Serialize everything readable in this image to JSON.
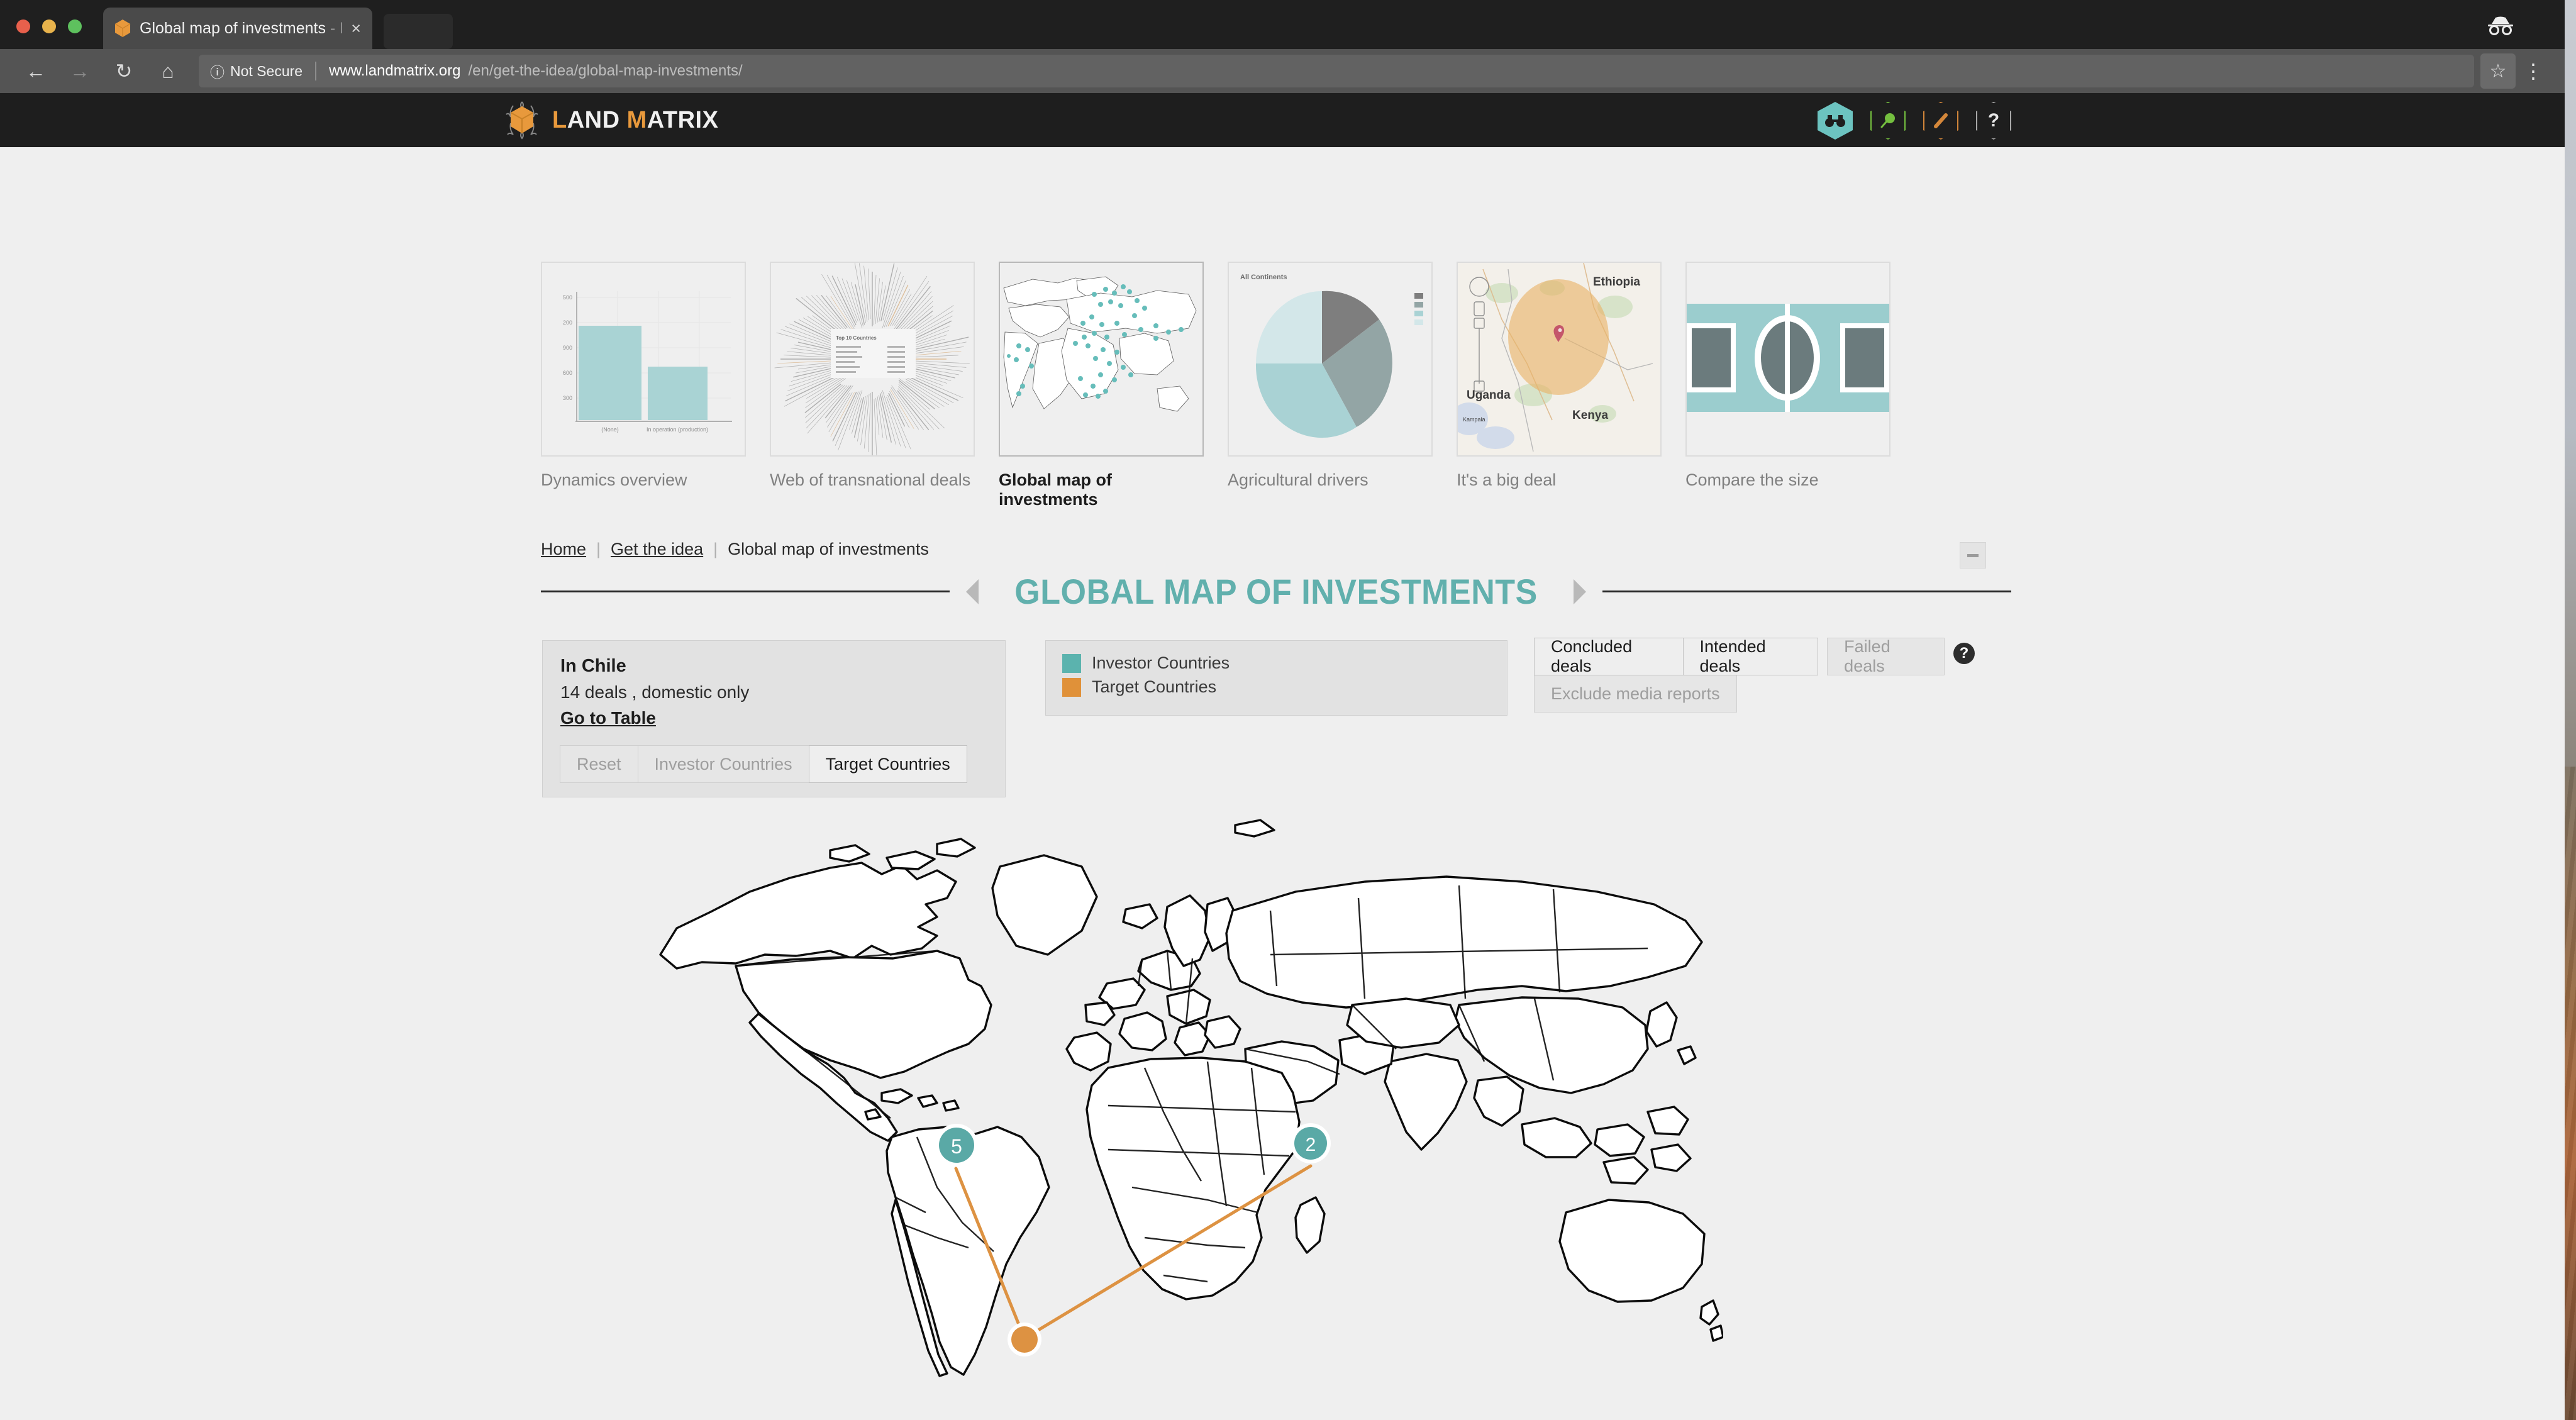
{
  "browser": {
    "tab_title": "Global map of investments",
    "tab_title_dim": " - L",
    "tab_close": "×",
    "url_notsecure": "Not Secure",
    "url_host": "www.landmatrix.org",
    "url_path": "/en/get-the-idea/global-map-investments/",
    "back_icon": "←",
    "forward_icon": "→",
    "reload_icon": "↻",
    "home_icon": "⌂",
    "star_icon": "☆",
    "kebab_icon": "⋮",
    "info_icon": "ⓘ"
  },
  "site": {
    "logo_first": "L",
    "logo_rest_1": "AND ",
    "logo_m": "M",
    "logo_rest_2": "ATRIX",
    "icons": [
      {
        "name": "binoculars-icon",
        "glyph": "🔭",
        "color": "#6cc3c0",
        "filled": true
      },
      {
        "name": "magnifier-icon",
        "glyph": "⚲",
        "color": "#74bf3f",
        "filled": false
      },
      {
        "name": "pencil-icon",
        "glyph": "╱",
        "color": "#d4873a",
        "filled": false
      },
      {
        "name": "question-icon",
        "glyph": "?",
        "color": "#a8a8a8",
        "filled": false
      }
    ]
  },
  "thumbnails": [
    {
      "label": "Dynamics overview",
      "kind": "bar",
      "active": false
    },
    {
      "label": "Web of transnational deals",
      "kind": "web",
      "active": false
    },
    {
      "label": "Global map of investments",
      "kind": "map",
      "active": true
    },
    {
      "label": "Agricultural drivers",
      "kind": "pie",
      "active": false
    },
    {
      "label": "It's a big deal",
      "kind": "geomap",
      "active": false
    },
    {
      "label": "Compare the size",
      "kind": "compare",
      "active": false
    }
  ],
  "thumb_details": {
    "bar": {
      "yticks": [
        "500",
        "200",
        "900",
        "600",
        "300"
      ],
      "xlabels": [
        "(None)",
        "In operation (production)"
      ],
      "values": [
        100,
        58
      ]
    },
    "web": {
      "caption": "Top 10 Countries"
    },
    "pie": {
      "title": "All Continents",
      "slices": [
        26,
        22,
        27,
        25
      ]
    },
    "geomap": {
      "labels": [
        "Ethiopia",
        "Uganda",
        "Kenya",
        "Kampala"
      ]
    }
  },
  "breadcrumb": {
    "home": "Home",
    "section": "Get the idea",
    "current": "Global map of investments",
    "separator": "|"
  },
  "title": "GLOBAL MAP OF INVESTMENTS",
  "info_panel": {
    "heading": "In Chile",
    "subtext": "14 deals , domestic only",
    "link": "Go to Table",
    "buttons": [
      {
        "label": "Reset",
        "active": false
      },
      {
        "label": "Investor Countries",
        "active": false
      },
      {
        "label": "Target Countries",
        "active": true
      }
    ]
  },
  "legend": {
    "items": [
      {
        "label": "Investor Countries",
        "color": "#5bb3ae"
      },
      {
        "label": "Target Countries",
        "color": "#e09139"
      }
    ]
  },
  "filters": {
    "row1": [
      {
        "label": "Concluded deals",
        "active": true
      },
      {
        "label": "Intended deals",
        "active": true
      },
      {
        "label": "Failed deals",
        "active": false
      }
    ],
    "row2": [
      {
        "label": "Exclude media reports",
        "active": false
      }
    ],
    "help_glyph": "?"
  },
  "chart_data": {
    "type": "map",
    "title": "GLOBAL MAP OF INVESTMENTS",
    "selected_country": "Chile",
    "selected_deals": 14,
    "selected_note": "domestic only",
    "markers": [
      {
        "id": "usa",
        "label": "5",
        "value": 5,
        "role": "investor",
        "color": "#5bb3ae",
        "x": 496,
        "y": 545
      },
      {
        "id": "spain",
        "label": "2",
        "value": 2,
        "role": "investor",
        "color": "#5bb3ae",
        "x": 697,
        "y": 538
      },
      {
        "id": "chile",
        "label": "",
        "value": 14,
        "role": "target",
        "color": "#e09139",
        "x": 548,
        "y": 723
      }
    ],
    "flows": [
      {
        "from": "usa",
        "to": "chile",
        "color": "#e09139"
      },
      {
        "from": "spain",
        "to": "chile",
        "color": "#e09139"
      }
    ],
    "legend": [
      "Investor Countries",
      "Target Countries"
    ]
  }
}
